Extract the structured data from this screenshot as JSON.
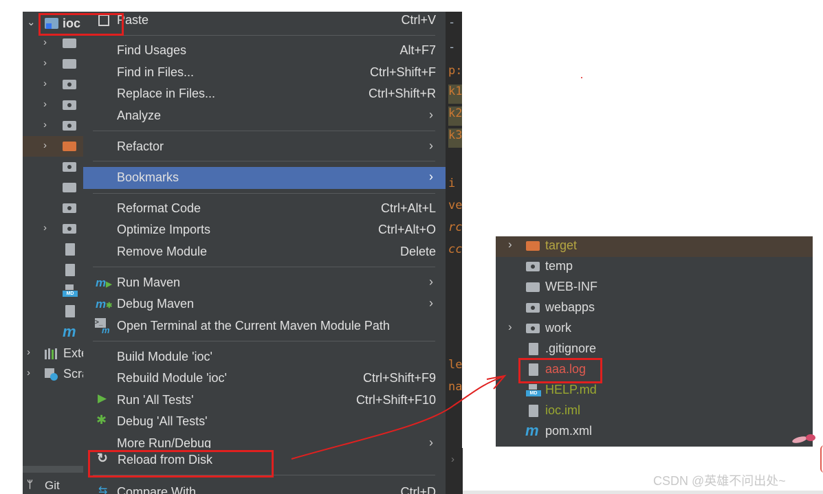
{
  "project_tree": {
    "root_label": "ioc",
    "external_libraries_label": "Exte",
    "scratches_label": "Scra",
    "git_tab": "Git"
  },
  "editor": {
    "fragments": [
      "-",
      "-",
      "p:",
      "k1",
      "k2",
      "k3",
      "i",
      "ve",
      "rc",
      "cc",
      "le",
      "na"
    ]
  },
  "context_menu": {
    "paste": {
      "label": "Paste",
      "shortcut": "Ctrl+V"
    },
    "find_usages": {
      "label": "Find Usages",
      "shortcut": "Alt+F7"
    },
    "find_in_files": {
      "label": "Find in Files...",
      "shortcut": "Ctrl+Shift+F"
    },
    "replace_in_files": {
      "label": "Replace in Files...",
      "shortcut": "Ctrl+Shift+R"
    },
    "analyze": {
      "label": "Analyze"
    },
    "refactor": {
      "label": "Refactor"
    },
    "bookmarks": {
      "label": "Bookmarks"
    },
    "reformat_code": {
      "label": "Reformat Code",
      "shortcut": "Ctrl+Alt+L"
    },
    "optimize_imports": {
      "label": "Optimize Imports",
      "shortcut": "Ctrl+Alt+O"
    },
    "remove_module": {
      "label": "Remove Module",
      "shortcut": "Delete"
    },
    "run_maven": {
      "label": "Run Maven"
    },
    "debug_maven": {
      "label": "Debug Maven"
    },
    "open_terminal": {
      "label": "Open Terminal at the Current Maven Module Path"
    },
    "build_module": {
      "label": "Build Module 'ioc'"
    },
    "rebuild_module": {
      "label": "Rebuild Module 'ioc'",
      "shortcut": "Ctrl+Shift+F9"
    },
    "run_all_tests": {
      "label": "Run 'All Tests'",
      "shortcut": "Ctrl+Shift+F10"
    },
    "debug_all_tests": {
      "label": "Debug 'All Tests'"
    },
    "more_run_debug": {
      "label": "More Run/Debug"
    },
    "reload_from_disk": {
      "label": "Reload from Disk"
    },
    "compare_with": {
      "label": "Compare With...",
      "shortcut": "Ctrl+D"
    }
  },
  "file_tree": {
    "items": [
      {
        "label": "target",
        "color": "#b5a642"
      },
      {
        "label": "temp",
        "color": "#dcdcdc"
      },
      {
        "label": "WEB-INF",
        "color": "#dcdcdc"
      },
      {
        "label": "webapps",
        "color": "#dcdcdc"
      },
      {
        "label": "work",
        "color": "#dcdcdc"
      },
      {
        "label": ".gitignore",
        "color": "#dcdcdc"
      },
      {
        "label": "aaa.log",
        "color": "#e05a4f"
      },
      {
        "label": "HELP.md",
        "color": "#9aa830"
      },
      {
        "label": "ioc.iml",
        "color": "#9aa830"
      },
      {
        "label": "pom.xml",
        "color": "#dcdcdc"
      }
    ]
  },
  "watermark": "CSDN @英雄不问出处~",
  "colors": {
    "panel_bg": "#3c3f41",
    "highlight": "#4b6eaf",
    "annotation_red": "#e0201f"
  }
}
